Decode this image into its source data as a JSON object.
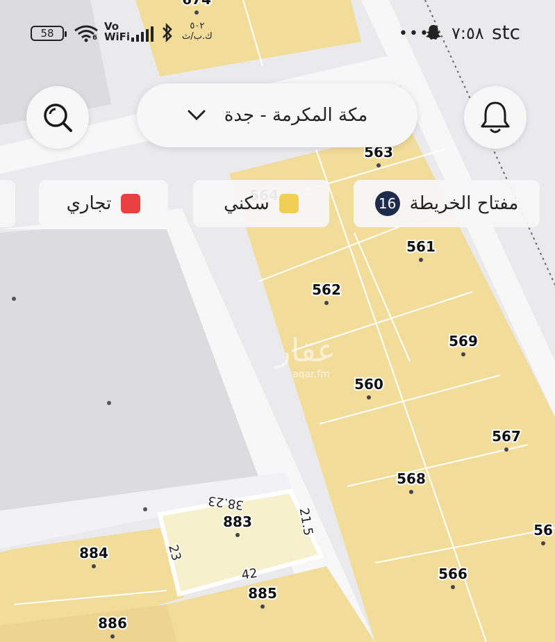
{
  "status_bar": {
    "battery": "58",
    "network_vo": "Vo",
    "network_wifi": "WiFi",
    "signal_num": "6",
    "data_speed": "٥٠٢",
    "data_unit": "ك.ب/ث",
    "time": "٧:٥٨",
    "carrier": "stc"
  },
  "header": {
    "city_selector": "مكة المكرمة - جدة"
  },
  "legend": {
    "map_key_label": "مفتاح الخريطة",
    "map_key_count": "16",
    "residential_label": "سكني",
    "commercial_label": "تجاري",
    "residential_color": "#f1cf55",
    "commercial_color": "#e84040"
  },
  "watermark": {
    "text": "عقار",
    "url": "aqar.fm"
  },
  "plots": [
    "674",
    "563",
    "564",
    "561",
    "562",
    "569",
    "560",
    "567",
    "568",
    "883",
    "884",
    "885",
    "886",
    "566",
    "56"
  ],
  "selected_plot": {
    "top": "38.23",
    "right": "21.5",
    "left": "23",
    "bottom": "42"
  },
  "icons": {
    "search": "search-icon",
    "bell": "bell-icon",
    "chevron": "chevron-down-icon"
  }
}
